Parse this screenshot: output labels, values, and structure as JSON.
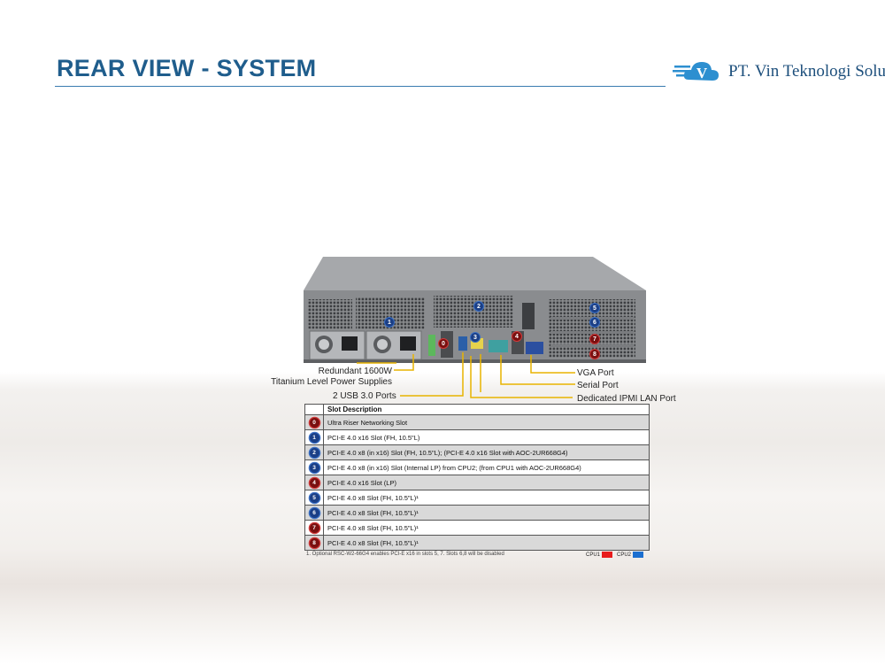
{
  "header": {
    "title": "REAR VIEW - SYSTEM",
    "company": "PT. Vin Teknologi Solusi"
  },
  "colors": {
    "title": "#1f5d8c",
    "cpu1": "#e81c1c",
    "cpu2": "#1c6fd0"
  },
  "callouts": {
    "power": [
      "Redundant 1600W",
      "Titanium Level Power Supplies"
    ],
    "usb": "2 USB 3.0 Ports",
    "vga": "VGA Port",
    "serial": "Serial Port",
    "ipmi": "Dedicated IPMI LAN Port"
  },
  "table": {
    "header": "Slot Description",
    "rows": [
      {
        "num": "0",
        "cpu": "cpu1",
        "desc": "Ultra Riser Networking Slot"
      },
      {
        "num": "1",
        "cpu": "cpu2",
        "desc": "PCI-E 4.0 x16 Slot (FH, 10.5\"L)"
      },
      {
        "num": "2",
        "cpu": "cpu2",
        "desc": "PCI-E 4.0 x8 (in x16) Slot (FH, 10.5\"L); (PCI-E 4.0 x16 Slot with AOC-2UR668G4)"
      },
      {
        "num": "3",
        "cpu": "cpu2",
        "desc": "PCI-E 4.0 x8 (in x16) Slot (Internal LP) from CPU2; (from CPU1 with AOC-2UR668G4)"
      },
      {
        "num": "4",
        "cpu": "cpu1",
        "desc": "PCI-E 4.0 x16 Slot (LP)"
      },
      {
        "num": "5",
        "cpu": "cpu2",
        "desc": "PCI-E 4.0 x8 Slot (FH, 10.5\"L)¹"
      },
      {
        "num": "6",
        "cpu": "cpu2",
        "desc": "PCI-E 4.0 x8 Slot (FH, 10.5\"L)¹"
      },
      {
        "num": "7",
        "cpu": "cpu1",
        "desc": "PCI-E 4.0 x8 Slot (FH, 10.5\"L)¹"
      },
      {
        "num": "8",
        "cpu": "cpu1",
        "desc": "PCI-E 4.0 x8 Slot (FH, 10.5\"L)¹"
      }
    ],
    "footnote": "1. Optional RSC-W2-66G4 enables PCI-E x16 in slots 5, 7.  Slots 6,8 will be disabled",
    "legend": {
      "cpu1": "CPU1",
      "cpu2": "CPU2"
    }
  },
  "badges": [
    {
      "num": "1",
      "cpu": "cpu2"
    },
    {
      "num": "2",
      "cpu": "cpu2"
    },
    {
      "num": "3",
      "cpu": "cpu2"
    },
    {
      "num": "0",
      "cpu": "cpu1"
    },
    {
      "num": "4",
      "cpu": "cpu1"
    },
    {
      "num": "5",
      "cpu": "cpu2"
    },
    {
      "num": "6",
      "cpu": "cpu2"
    },
    {
      "num": "7",
      "cpu": "cpu1"
    },
    {
      "num": "8",
      "cpu": "cpu1"
    }
  ]
}
